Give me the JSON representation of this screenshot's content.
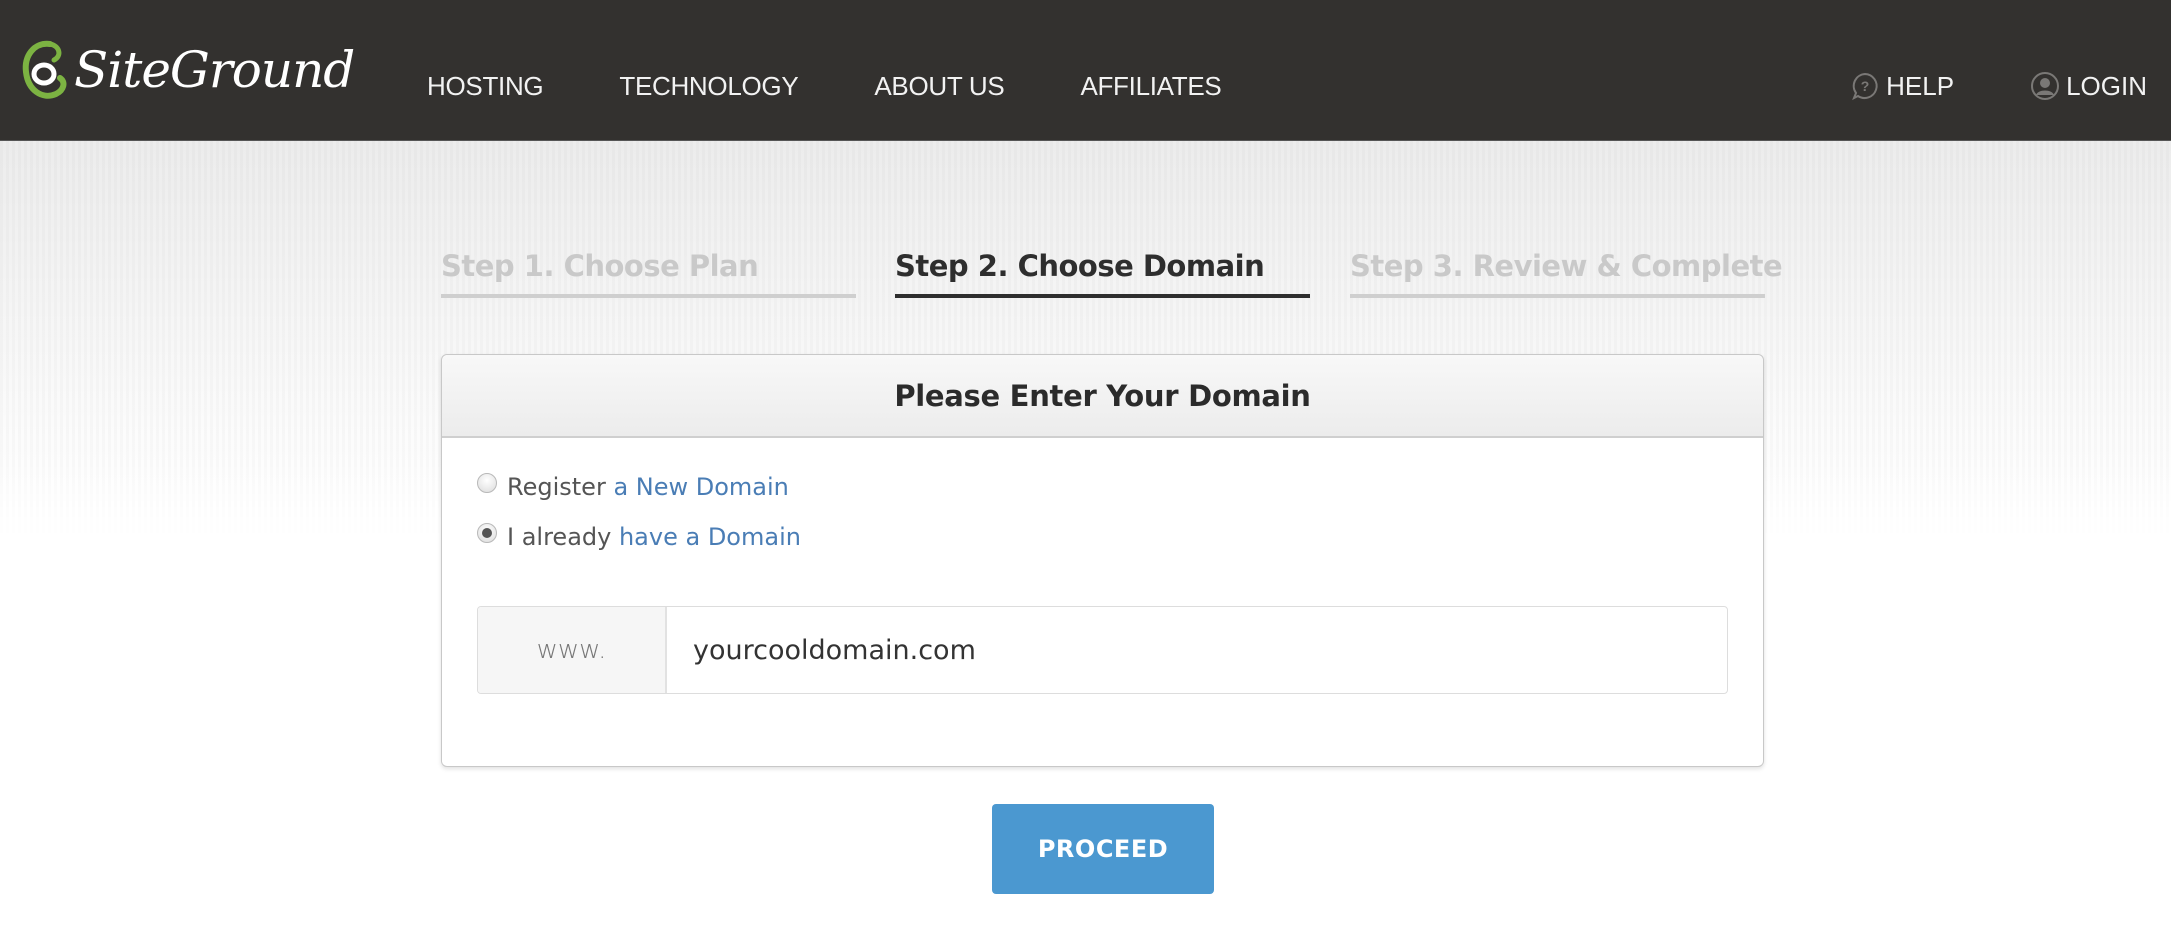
{
  "header": {
    "brand": "SiteGround",
    "nav": [
      {
        "label": "HOSTING"
      },
      {
        "label": "TECHNOLOGY"
      },
      {
        "label": "ABOUT US"
      },
      {
        "label": "AFFILIATES"
      }
    ],
    "help": {
      "label": "HELP",
      "icon": "question-bubble-icon"
    },
    "login": {
      "label": "LOGIN",
      "icon": "user-circle-icon"
    }
  },
  "steps": [
    {
      "label": "Step 1. Choose Plan",
      "state": "inactive"
    },
    {
      "label": "Step 2. Choose Domain",
      "state": "active"
    },
    {
      "label": "Step 3. Review & Complete",
      "state": "inactive"
    }
  ],
  "panel": {
    "title": "Please Enter Your Domain",
    "options": [
      {
        "prefix": "Register ",
        "link": "a New Domain",
        "checked": false
      },
      {
        "prefix": "I already ",
        "link": "have a Domain",
        "checked": true
      }
    ],
    "domain": {
      "addon": "www.",
      "value": "yourcooldomain.com"
    }
  },
  "actions": {
    "proceed_label": "PROCEED"
  },
  "colors": {
    "header_bg": "#33312f",
    "brand_green": "#7cb342",
    "link": "#4a7db5",
    "primary_button": "#4b98d0",
    "active_step": "#2e2e2e",
    "inactive_step": "#c9c9c9"
  }
}
